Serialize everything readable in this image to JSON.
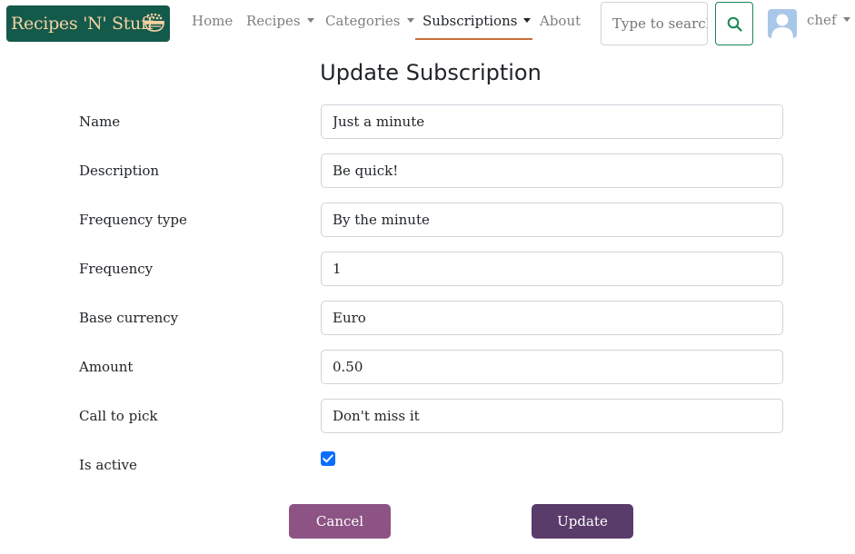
{
  "navbar": {
    "brand": "Recipes 'N' Stuff",
    "items": [
      {
        "label": "Home"
      },
      {
        "label": "Recipes"
      },
      {
        "label": "Categories"
      },
      {
        "label": "Subscriptions"
      },
      {
        "label": "About"
      }
    ],
    "active_item": "Subscriptions",
    "search": {
      "placeholder": "Type to search",
      "value": ""
    },
    "user": {
      "name": "chef"
    }
  },
  "form": {
    "title": "Update Subscription",
    "fields": [
      {
        "label": "Name",
        "value": "Just a minute"
      },
      {
        "label": "Description",
        "value": "Be quick!"
      },
      {
        "label": "Frequency type",
        "value": "By the minute"
      },
      {
        "label": "Frequency",
        "value": "1"
      },
      {
        "label": "Base currency",
        "value": "Euro"
      },
      {
        "label": "Amount",
        "value": "0.50"
      },
      {
        "label": "Call to pick",
        "value": "Don't miss it"
      }
    ],
    "is_active": {
      "label": "Is active",
      "checked": true
    },
    "cancel_label": "Cancel",
    "update_label": "Update"
  },
  "colors": {
    "brand_bg": "#145a4b",
    "brand_text": "#f3d3a3",
    "active_underline": "#c8703a",
    "search_button_border": "#198754",
    "checkbox": "#0d6efd",
    "cancel_button": "#8c5384",
    "update_button": "#5a3c6b"
  },
  "icons": {
    "brand": "rice-bowl-icon",
    "search": "search-icon",
    "avatar": "user-avatar-icon",
    "dropdown": "caret-down-icon"
  }
}
